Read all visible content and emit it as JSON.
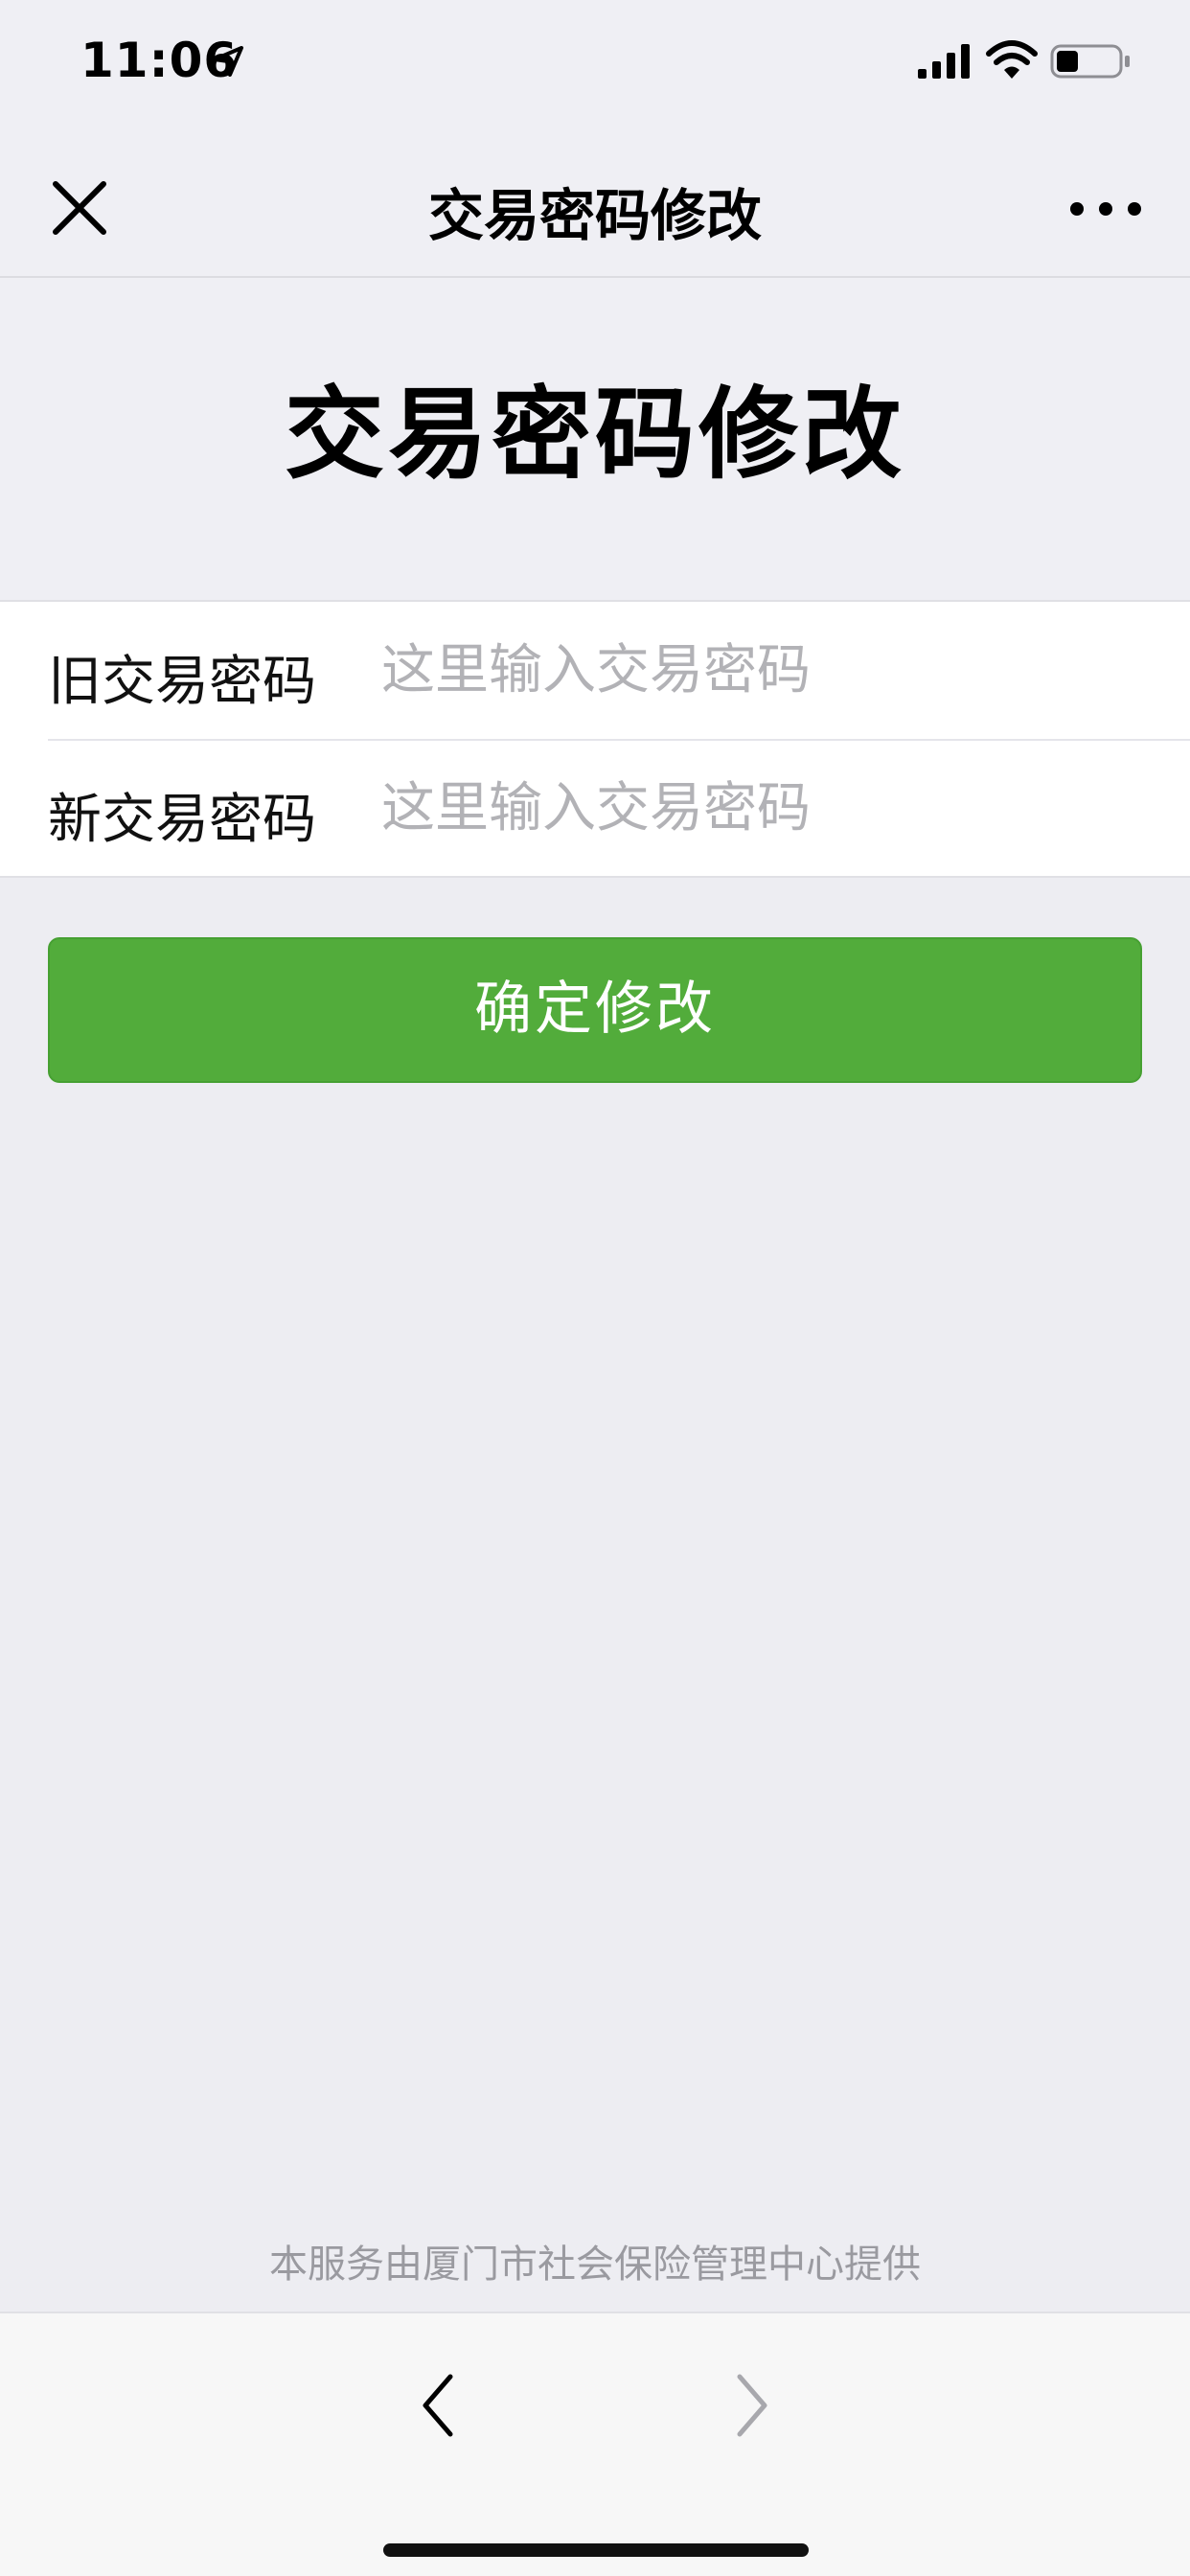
{
  "status_bar": {
    "time": "11:06"
  },
  "nav_bar": {
    "title": "交易密码修改",
    "close_icon": "close-icon",
    "more_icon": "more-icon"
  },
  "page": {
    "title": "交易密码修改"
  },
  "form": {
    "old_password": {
      "label": "旧交易密码",
      "placeholder": "这里输入交易密码"
    },
    "new_password": {
      "label": "新交易密码",
      "placeholder": "这里输入交易密码"
    }
  },
  "confirm_button": {
    "label": "确定修改",
    "color": "#52AC3B"
  },
  "footer": {
    "note": "本服务由厦门市社会保险管理中心提供"
  },
  "bottom_bar": {
    "back_icon": "chevron-left-icon",
    "forward_icon": "chevron-right-icon"
  }
}
